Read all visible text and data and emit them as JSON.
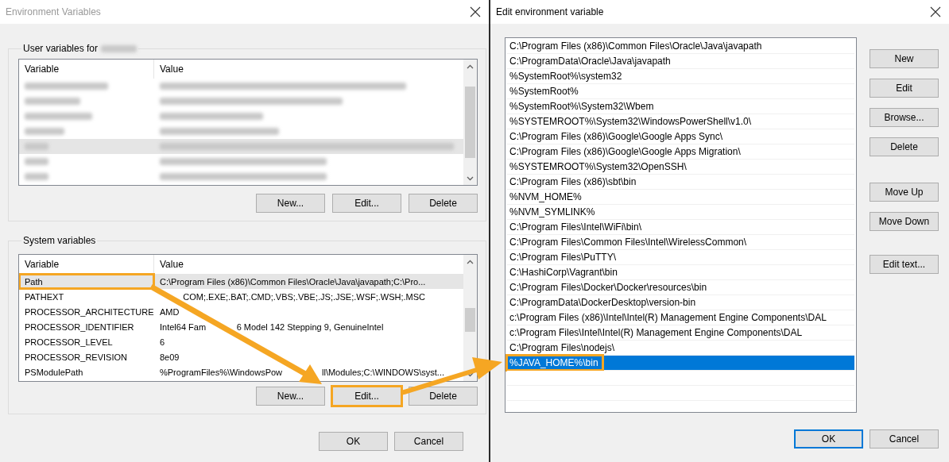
{
  "left_window": {
    "title": "Environment Variables",
    "user_variables": {
      "label": "User variables for",
      "columns": [
        "Variable",
        "Value"
      ],
      "rows": [
        {
          "selected": false
        },
        {
          "selected": false
        },
        {
          "selected": false
        },
        {
          "selected": false
        },
        {
          "selected": true
        },
        {
          "selected": false
        },
        {
          "selected": false
        }
      ],
      "buttons": [
        {
          "label": "New...",
          "highlighted": false
        },
        {
          "label": "Edit...",
          "highlighted": false
        },
        {
          "label": "Delete",
          "highlighted": false
        }
      ]
    },
    "system_variables": {
      "label": "System variables",
      "columns": [
        "Variable",
        "Value"
      ],
      "rows": [
        {
          "variable": "Path",
          "value": "C:\\Program Files (x86)\\Common Files\\Oracle\\Java\\javapath;C:\\Pro...",
          "selected": true,
          "highlighted": true
        },
        {
          "variable": "PATHEXT",
          "value_after": "COM;.EXE;.BAT;.CMD;.VBS;.VBE;.JS;.JSE;.WSF;.WSH;.MSC",
          "selected": false,
          "highlighted": false
        },
        {
          "variable": "PROCESSOR_ARCHITECTURE",
          "value_before": "AMD",
          "selected": false,
          "highlighted": false
        },
        {
          "variable": "PROCESSOR_IDENTIFIER",
          "value_before": "Intel64 Fam",
          "value_after": "6 Model 142 Stepping 9, GenuineIntel",
          "selected": false,
          "highlighted": false
        },
        {
          "variable": "PROCESSOR_LEVEL",
          "value": "6",
          "selected": false,
          "highlighted": false
        },
        {
          "variable": "PROCESSOR_REVISION",
          "value": "8e09",
          "selected": false,
          "highlighted": false
        },
        {
          "variable": "PSModulePath",
          "value_before": "%ProgramFiles%\\WindowsPow",
          "value_after": "ll\\Modules;C:\\WINDOWS\\syst...",
          "selected": false,
          "highlighted": false
        }
      ],
      "buttons": [
        {
          "label": "New...",
          "highlighted": false
        },
        {
          "label": "Edit...",
          "highlighted": true
        },
        {
          "label": "Delete",
          "highlighted": false
        }
      ]
    },
    "buttons": [
      {
        "label": "OK",
        "default": false
      },
      {
        "label": "Cancel",
        "default": false
      }
    ]
  },
  "right_window": {
    "title": "Edit environment variable",
    "items": [
      {
        "text": "C:\\Program Files (x86)\\Common Files\\Oracle\\Java\\javapath",
        "selected": false,
        "highlighted": false
      },
      {
        "text": "C:\\ProgramData\\Oracle\\Java\\javapath",
        "selected": false,
        "highlighted": false
      },
      {
        "text": "%SystemRoot%\\system32",
        "selected": false,
        "highlighted": false
      },
      {
        "text": "%SystemRoot%",
        "selected": false,
        "highlighted": false
      },
      {
        "text": "%SystemRoot%\\System32\\Wbem",
        "selected": false,
        "highlighted": false
      },
      {
        "text": "%SYSTEMROOT%\\System32\\WindowsPowerShell\\v1.0\\",
        "selected": false,
        "highlighted": false
      },
      {
        "text": "C:\\Program Files (x86)\\Google\\Google Apps Sync\\",
        "selected": false,
        "highlighted": false
      },
      {
        "text": "C:\\Program Files (x86)\\Google\\Google Apps Migration\\",
        "selected": false,
        "highlighted": false
      },
      {
        "text": "%SYSTEMROOT%\\System32\\OpenSSH\\",
        "selected": false,
        "highlighted": false
      },
      {
        "text": "C:\\Program Files (x86)\\sbt\\bin",
        "selected": false,
        "highlighted": false
      },
      {
        "text": "%NVM_HOME%",
        "selected": false,
        "highlighted": false
      },
      {
        "text": "%NVM_SYMLINK%",
        "selected": false,
        "highlighted": false
      },
      {
        "text": "C:\\Program Files\\Intel\\WiFi\\bin\\",
        "selected": false,
        "highlighted": false
      },
      {
        "text": "C:\\Program Files\\Common Files\\Intel\\WirelessCommon\\",
        "selected": false,
        "highlighted": false
      },
      {
        "text": "C:\\Program Files\\PuTTY\\",
        "selected": false,
        "highlighted": false
      },
      {
        "text": "C:\\HashiCorp\\Vagrant\\bin",
        "selected": false,
        "highlighted": false
      },
      {
        "text": "C:\\Program Files\\Docker\\Docker\\resources\\bin",
        "selected": false,
        "highlighted": false
      },
      {
        "text": "C:\\ProgramData\\DockerDesktop\\version-bin",
        "selected": false,
        "highlighted": false
      },
      {
        "text": "c:\\Program Files (x86)\\Intel\\Intel(R) Management Engine Components\\DAL",
        "selected": false,
        "highlighted": false
      },
      {
        "text": "c:\\Program Files\\Intel\\Intel(R) Management Engine Components\\DAL",
        "selected": false,
        "highlighted": false
      },
      {
        "text": "C:\\Program Files\\nodejs\\",
        "selected": false,
        "highlighted": false
      },
      {
        "text": "%JAVA_HOME%\\bin",
        "selected": true,
        "highlighted": true
      }
    ],
    "button_groups": [
      [
        "New",
        "Edit",
        "Browse...",
        "Delete"
      ],
      [
        "Move Up",
        "Move Down"
      ],
      [
        "Edit text..."
      ]
    ],
    "buttons": [
      {
        "label": "OK",
        "default": true
      },
      {
        "label": "Cancel",
        "default": false
      }
    ]
  }
}
